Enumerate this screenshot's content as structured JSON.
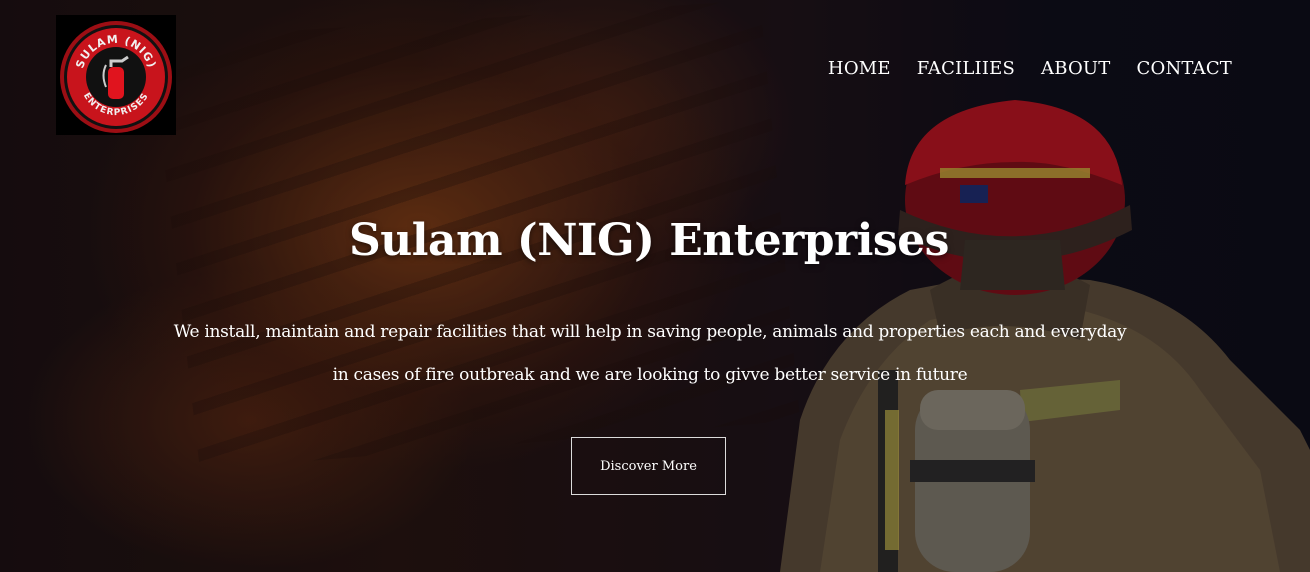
{
  "brand": {
    "logo_text_top": "SULAM (NIG)",
    "logo_text_bottom": "ENTERPRISES",
    "logo_ring_color": "#c8141c",
    "logo_bg_color": "#000000"
  },
  "nav": {
    "items": [
      {
        "label": "HOME"
      },
      {
        "label": "FACILIIES"
      },
      {
        "label": "ABOUT"
      },
      {
        "label": "CONTACT"
      }
    ]
  },
  "hero": {
    "title": "Sulam (NIG) Enterprises",
    "description_line1": "We install, maintain and repair facilities that will help in saving people, animals and properties each and everyday",
    "description_line2": "in cases of fire outbreak and we are looking to givve better service in future",
    "cta_label": "Discover More",
    "background": "fire-and-firefighter-photo",
    "helmet_color": "#b3121c"
  }
}
